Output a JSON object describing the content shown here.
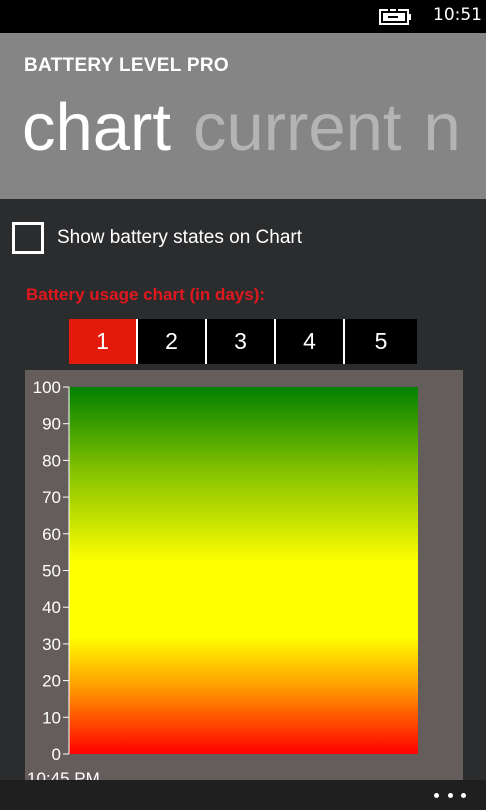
{
  "status": {
    "time": "10:51",
    "battery_icon": "battery-charging-icon"
  },
  "header": {
    "app_title": "BATTERY LEVEL PRO",
    "pivots": [
      "chart",
      "current",
      "n"
    ]
  },
  "options": {
    "show_states_label": "Show battery states on Chart",
    "show_states_checked": false
  },
  "chart_section": {
    "title": "Battery usage chart (in days):",
    "days": [
      "1",
      "2",
      "3",
      "4",
      "5"
    ],
    "selected_day": "1"
  },
  "chart_data": {
    "type": "area",
    "y_ticks": [
      "100",
      "90",
      "80",
      "70",
      "60",
      "50",
      "40",
      "30",
      "20",
      "10",
      "0"
    ],
    "ylim": [
      0,
      100
    ],
    "x_tick_labels": [
      "10:45 PM"
    ],
    "gradient_colors": {
      "top": "#008000",
      "middle": "#ffff00",
      "bottom": "#ff0000"
    }
  },
  "appbar": {
    "more_icon": "ellipsis-icon"
  }
}
